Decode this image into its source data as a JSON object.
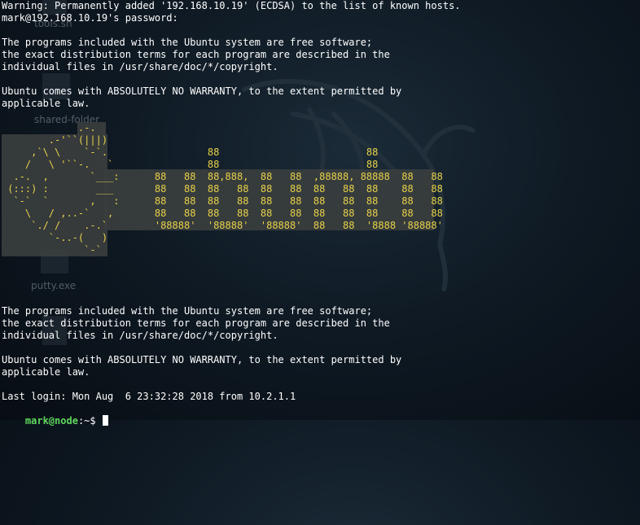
{
  "desktop": {
    "icons": [
      {
        "label": "tools.sh"
      },
      {
        "label": "shared-folder"
      },
      {
        "label": "putty.exe"
      }
    ]
  },
  "terminal": {
    "header_lines": [
      "Warning: Permanently added '192.168.10.19' (ECDSA) to the list of known hosts.",
      "mark@192.168.10.19's password:",
      "",
      "The programs included with the Ubuntu system are free software;",
      "the exact distribution terms for each program are described in the",
      "individual files in /usr/share/doc/*/copyright.",
      "",
      "Ubuntu comes with ABSOLUTELY NO WARRANTY, to the extent permitted by",
      "applicable law."
    ],
    "banner_lines": [
      "             .-.",
      "        .-'``(|||)",
      "     ,`\\ \\    `-`.                 88                         88",
      "    /   \\ '``-.   `                88                         88",
      "  .-.  ,       `___:      88   88  88,888,  88   88  ,88888, 88888  88   88",
      " (:::) :        ___       88   88  88   88  88   88  88   88  88    88   88",
      "  `-`  `       ,   :      88   88  88   88  88   88  88   88  88    88   88",
      "    \\   / ,..-`   ,       88   88  88   88  88   88  88   88  88    88   88",
      "     `./ /    .-.`        '88888'  '88888'  '88888'  88   88  '8888 '88888'",
      "        `-..-(   )",
      "              `-`"
    ],
    "footer_lines": [
      "The programs included with the Ubuntu system are free software;",
      "the exact distribution terms for each program are described in the",
      "individual files in /usr/share/doc/*/copyright.",
      "",
      "Ubuntu comes with ABSOLUTELY NO WARRANTY, to the extent permitted by",
      "applicable law.",
      "",
      "Last login: Mon Aug  6 23:32:28 2018 from 10.2.1.1"
    ],
    "prompt": {
      "user_host": "mark@node",
      "path_suffix": ":~$ "
    }
  }
}
